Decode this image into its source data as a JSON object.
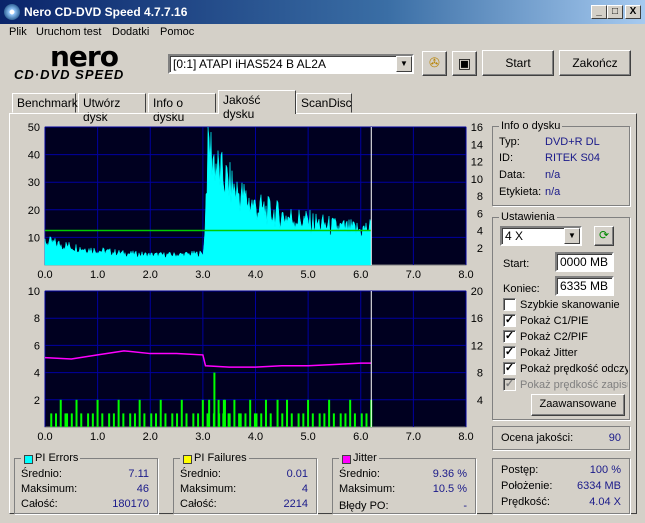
{
  "window": {
    "title": "Nero CD-DVD Speed 4.7.7.16",
    "min": "_",
    "max": "□",
    "close": "X"
  },
  "menu": [
    "Plik",
    "Uruchom test",
    "Dodatki",
    "Pomoc"
  ],
  "logo": {
    "top": "nero",
    "bottom": "CD·DVD SPEED"
  },
  "drive": {
    "value": "[0:1]   ATAPI iHAS524   B AL2A"
  },
  "toolbar": {
    "start": "Start",
    "end": "Zakończ"
  },
  "tabs": [
    "Benchmark",
    "Utwórz dysk",
    "Info o dysku",
    "Jakość dysku",
    "ScanDisc"
  ],
  "disc_info": {
    "title": "Info o dysku",
    "type_label": "Typ:",
    "type": "DVD+R DL",
    "id_label": "ID:",
    "id": "RITEK S04",
    "date_label": "Data:",
    "date": "n/a",
    "tag_label": "Etykieta:",
    "tag": "n/a"
  },
  "settings": {
    "title": "Ustawienia",
    "speed": "4 X",
    "start_label": "Start:",
    "start": "0000 MB",
    "end_label": "Koniec:",
    "end": "6335 MB",
    "options": [
      {
        "label": "Szybkie skanowanie",
        "checked": false,
        "disabled": false
      },
      {
        "label": "Pokaż C1/PIE",
        "checked": true,
        "disabled": false
      },
      {
        "label": "Pokaż C2/PIF",
        "checked": true,
        "disabled": false
      },
      {
        "label": "Pokaż Jitter",
        "checked": true,
        "disabled": false
      },
      {
        "label": "Pokaż prędkość odczy",
        "checked": true,
        "disabled": false
      },
      {
        "label": "Pokaż prędkość zapisu",
        "checked": true,
        "disabled": true
      }
    ],
    "advanced": "Zaawansowane"
  },
  "quality": {
    "label": "Ocena jakości:",
    "value": "90"
  },
  "progress": {
    "progress_label": "Postęp:",
    "progress": "100 %",
    "position_label": "Położenie:",
    "position": "6334 MB",
    "speed_label": "Prędkość:",
    "speed": "4.04 X"
  },
  "pi_errors": {
    "title": "PI Errors",
    "color": "#00ffff",
    "avg_label": "Średnio:",
    "avg": "7.11",
    "max_label": "Maksimum:",
    "max": "46",
    "total_label": "Całość:",
    "total": "180170"
  },
  "pi_failures": {
    "title": "PI Failures",
    "color": "#ffff00",
    "avg_label": "Średnio:",
    "avg": "0.01",
    "max_label": "Maksimum:",
    "max": "4",
    "total_label": "Całość:",
    "total": "2214"
  },
  "jitter": {
    "title": "Jitter",
    "color": "#ff00ff",
    "avg_label": "Średnio:",
    "avg": "9.36 %",
    "max_label": "Maksimum:",
    "max": "10.5 %",
    "po_label": "Błędy PO:",
    "po": "-"
  },
  "chart_data": [
    {
      "type": "area",
      "name": "PI Errors",
      "x_ticks": [
        "0.0",
        "1.0",
        "2.0",
        "3.0",
        "4.0",
        "5.0",
        "6.0",
        "7.0",
        "8.0"
      ],
      "y_left_ticks": [
        "50",
        "40",
        "30",
        "20",
        "10"
      ],
      "y_right_ticks": [
        "16",
        "14",
        "12",
        "10",
        "8",
        "6",
        "4",
        "2"
      ],
      "xlim": [
        0,
        8
      ],
      "ylim": [
        0,
        50
      ],
      "y2lim": [
        0,
        16
      ],
      "series": [
        {
          "name": "PI Errors",
          "color": "#00ffff",
          "x": [
            0,
            0.3,
            0.6,
            1,
            1.5,
            2,
            2.5,
            3,
            3.02,
            3.1,
            3.3,
            3.6,
            4,
            4.5,
            5,
            5.5,
            6,
            6.2
          ],
          "y": [
            8,
            7,
            6,
            5,
            4,
            3.5,
            3.5,
            4,
            6,
            42,
            32,
            26,
            20,
            17,
            15,
            13,
            12,
            13
          ]
        },
        {
          "name": "Read speed",
          "color": "#00cc00",
          "x": [
            0,
            6.2
          ],
          "y": [
            4,
            4
          ],
          "axis": "right"
        }
      ],
      "marker_x": 6.2
    },
    {
      "type": "bar",
      "name": "PI Failures / Jitter",
      "x_ticks": [
        "0.0",
        "1.0",
        "2.0",
        "3.0",
        "4.0",
        "5.0",
        "6.0",
        "7.0",
        "8.0"
      ],
      "y_left_ticks": [
        "10",
        "8",
        "6",
        "4",
        "2"
      ],
      "y_right_ticks": [
        "20",
        "16",
        "12",
        "8",
        "4"
      ],
      "xlim": [
        0,
        8
      ],
      "ylim": [
        0,
        10
      ],
      "y2lim": [
        0,
        20
      ],
      "series": [
        {
          "name": "PI Failures",
          "color": "#00ff00",
          "x": [
            0.1,
            0.4,
            0.8,
            1.2,
            1.6,
            2.0,
            2.4,
            2.8,
            3.1,
            3.2,
            3.4,
            3.7,
            4.0,
            4.4,
            4.8,
            5.2,
            5.6,
            6.0
          ],
          "y": [
            1,
            1,
            1,
            1,
            1,
            1,
            1,
            1,
            2,
            4,
            2,
            1,
            1,
            2,
            1,
            1,
            1,
            1
          ]
        },
        {
          "name": "Jitter",
          "color": "#ff00ff",
          "x": [
            0,
            0.5,
            1,
            1.5,
            2,
            2.5,
            3,
            3.05,
            3.5,
            4,
            4.5,
            5,
            5.5,
            6,
            6.2
          ],
          "y": [
            10.2,
            10.0,
            10.6,
            11.2,
            10.8,
            10.8,
            10.6,
            9.0,
            8.8,
            8.8,
            9.0,
            9.0,
            9.2,
            9.4,
            9.4
          ],
          "axis": "right"
        }
      ],
      "marker_x": 6.2
    }
  ]
}
